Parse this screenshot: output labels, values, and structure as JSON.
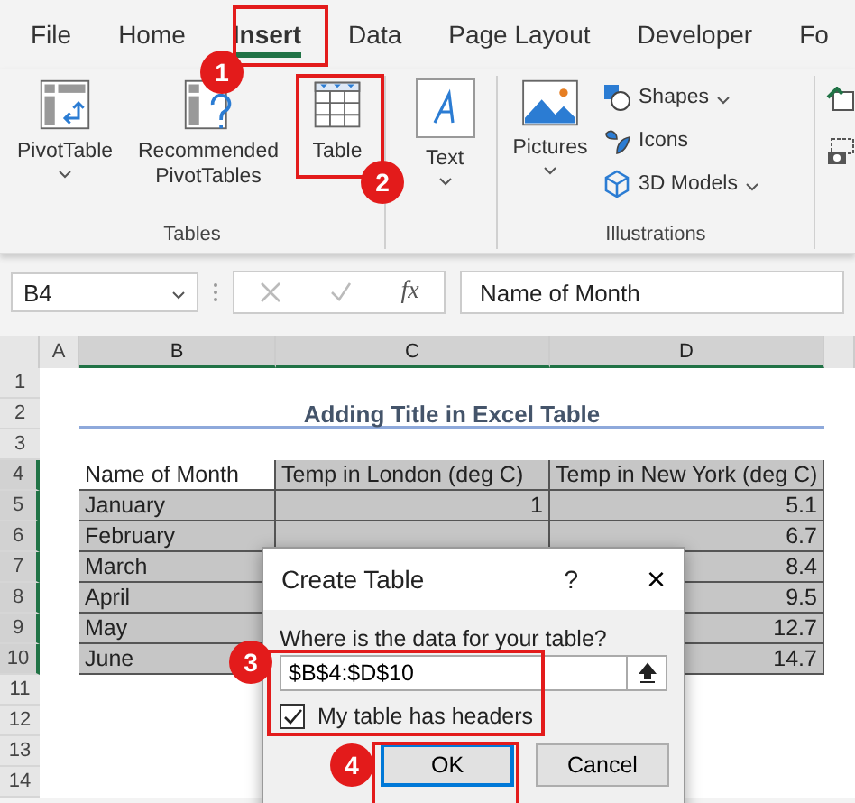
{
  "ribbon_tabs": [
    {
      "label": "File",
      "selected": false
    },
    {
      "label": "Home",
      "selected": false
    },
    {
      "label": "Insert",
      "selected": true
    },
    {
      "label": "Data",
      "selected": false
    },
    {
      "label": "Page Layout",
      "selected": false
    },
    {
      "label": "Developer",
      "selected": false
    },
    {
      "label": "Fo",
      "selected": false
    }
  ],
  "ribbon_groups": [
    {
      "label": "Tables",
      "buttons": [
        {
          "kind": "pivot",
          "label": "PivotTable",
          "dropdown": true
        },
        {
          "kind": "recommended",
          "label": "Recommended PivotTables",
          "dropdown": false
        },
        {
          "kind": "table",
          "label": "Table",
          "dropdown": false
        }
      ]
    },
    {
      "buttons": [
        {
          "kind": "text",
          "label": "Text",
          "dropdown": true
        }
      ]
    },
    {
      "label": "Illustrations",
      "buttons": [
        {
          "kind": "pictures",
          "label": "Pictures",
          "dropdown": true
        }
      ],
      "small": [
        {
          "kind": "shapes",
          "label": "Shapes",
          "dropdown": true
        },
        {
          "kind": "icons",
          "label": "Icons",
          "dropdown": false
        },
        {
          "kind": "models",
          "label": "3D Models",
          "dropdown": true
        }
      ]
    }
  ],
  "name_box": "B4",
  "fx": "fx",
  "formula": "Name of Month",
  "columns": [
    "A",
    "B",
    "C",
    "D"
  ],
  "row_numbers": [
    "1",
    "2",
    "3",
    "4",
    "5",
    "6",
    "7",
    "8",
    "9",
    "10",
    "11",
    "12",
    "13",
    "14"
  ],
  "sheet_title": "Adding Title in Excel Table",
  "table": {
    "header": [
      "Name of Month",
      "Temp in London (deg C)",
      "Temp in New York (deg C)"
    ],
    "rows": [
      [
        "January",
        "1",
        "5.1"
      ],
      [
        "February",
        "",
        "6.7"
      ],
      [
        "March",
        "",
        "8.4"
      ],
      [
        "April",
        "",
        "9.5"
      ],
      [
        "May",
        "",
        "12.7"
      ],
      [
        "June",
        "",
        "14.7"
      ]
    ]
  },
  "callouts": [
    "1",
    "2",
    "3",
    "4"
  ],
  "dialog": {
    "title": "Create Table",
    "help": "?",
    "close": "×",
    "prompt": "Where is the data for your table?",
    "range": "$B$4:$D$10",
    "checkbox": {
      "label": "My table has headers",
      "checked": true
    },
    "buttons": [
      {
        "label": "OK",
        "kind": "default"
      },
      {
        "label": "Cancel",
        "kind": "normal"
      }
    ]
  }
}
